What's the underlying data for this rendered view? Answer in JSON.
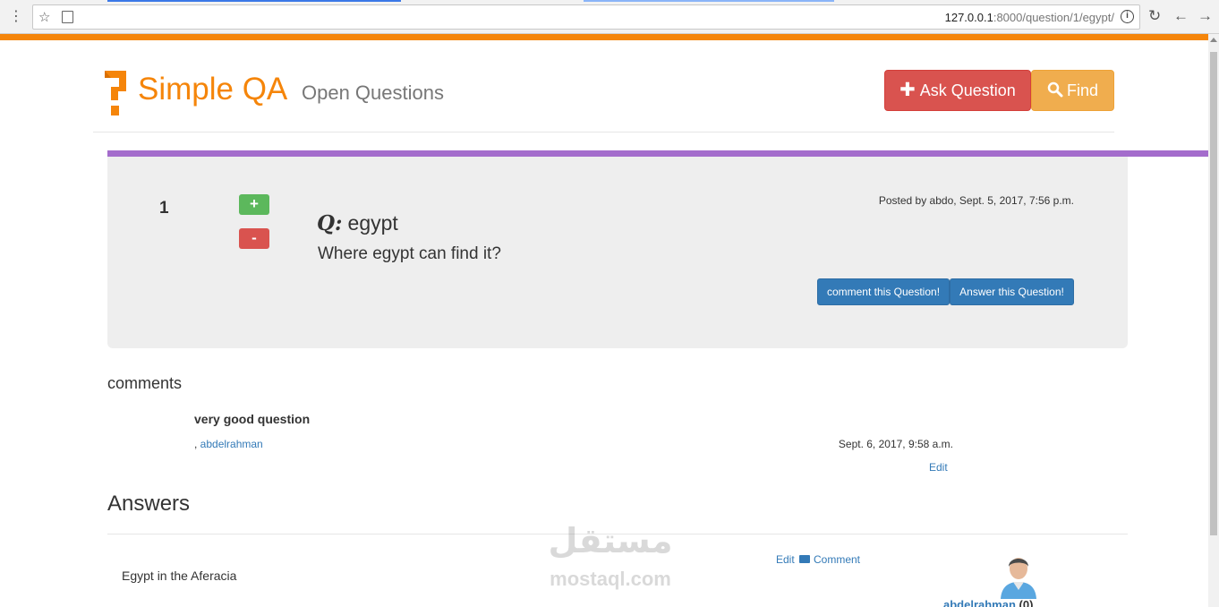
{
  "browser": {
    "url_host": "127.0.0.1",
    "url_rest": ":8000/question/1/egypt/",
    "icons": [
      "menu-icon",
      "star-icon",
      "page-icon",
      "info-icon",
      "reload-icon",
      "back-icon",
      "forward-icon"
    ]
  },
  "header": {
    "brand": "Simple QA",
    "subtitle": "Open Questions",
    "ask_label": "Ask Question",
    "find_label": "Find",
    "colors": {
      "brand": "#f5850a",
      "ask": "#d9534f",
      "find": "#f0ad4e"
    }
  },
  "question": {
    "votes": "1",
    "upvote_label": "+",
    "downvote_label": "-",
    "posted": "Posted by abdo, Sept. 5, 2017, 7:56 p.m.",
    "title_prefix": "Q:",
    "title": "egypt",
    "body": "Where egypt can find it?",
    "comment_btn": "comment this Question!",
    "answer_btn": "Answer this Question!",
    "accent": "#a46ccc"
  },
  "comments": {
    "heading": "comments",
    "items": [
      {
        "text": "very good question",
        "prefix": ", ",
        "author": "abdelrahman",
        "date": "Sept. 6, 2017, 9:58 a.m.",
        "edit": "Edit"
      }
    ]
  },
  "answers": {
    "heading": "Answers",
    "items": [
      {
        "text": "Egypt in the Aferacia",
        "edit": "Edit",
        "comment": "Comment",
        "author": "abdelrahman",
        "rep": "(0)"
      }
    ]
  },
  "watermark": {
    "arabic": "مستقل",
    "latin": "mostaql.com"
  }
}
